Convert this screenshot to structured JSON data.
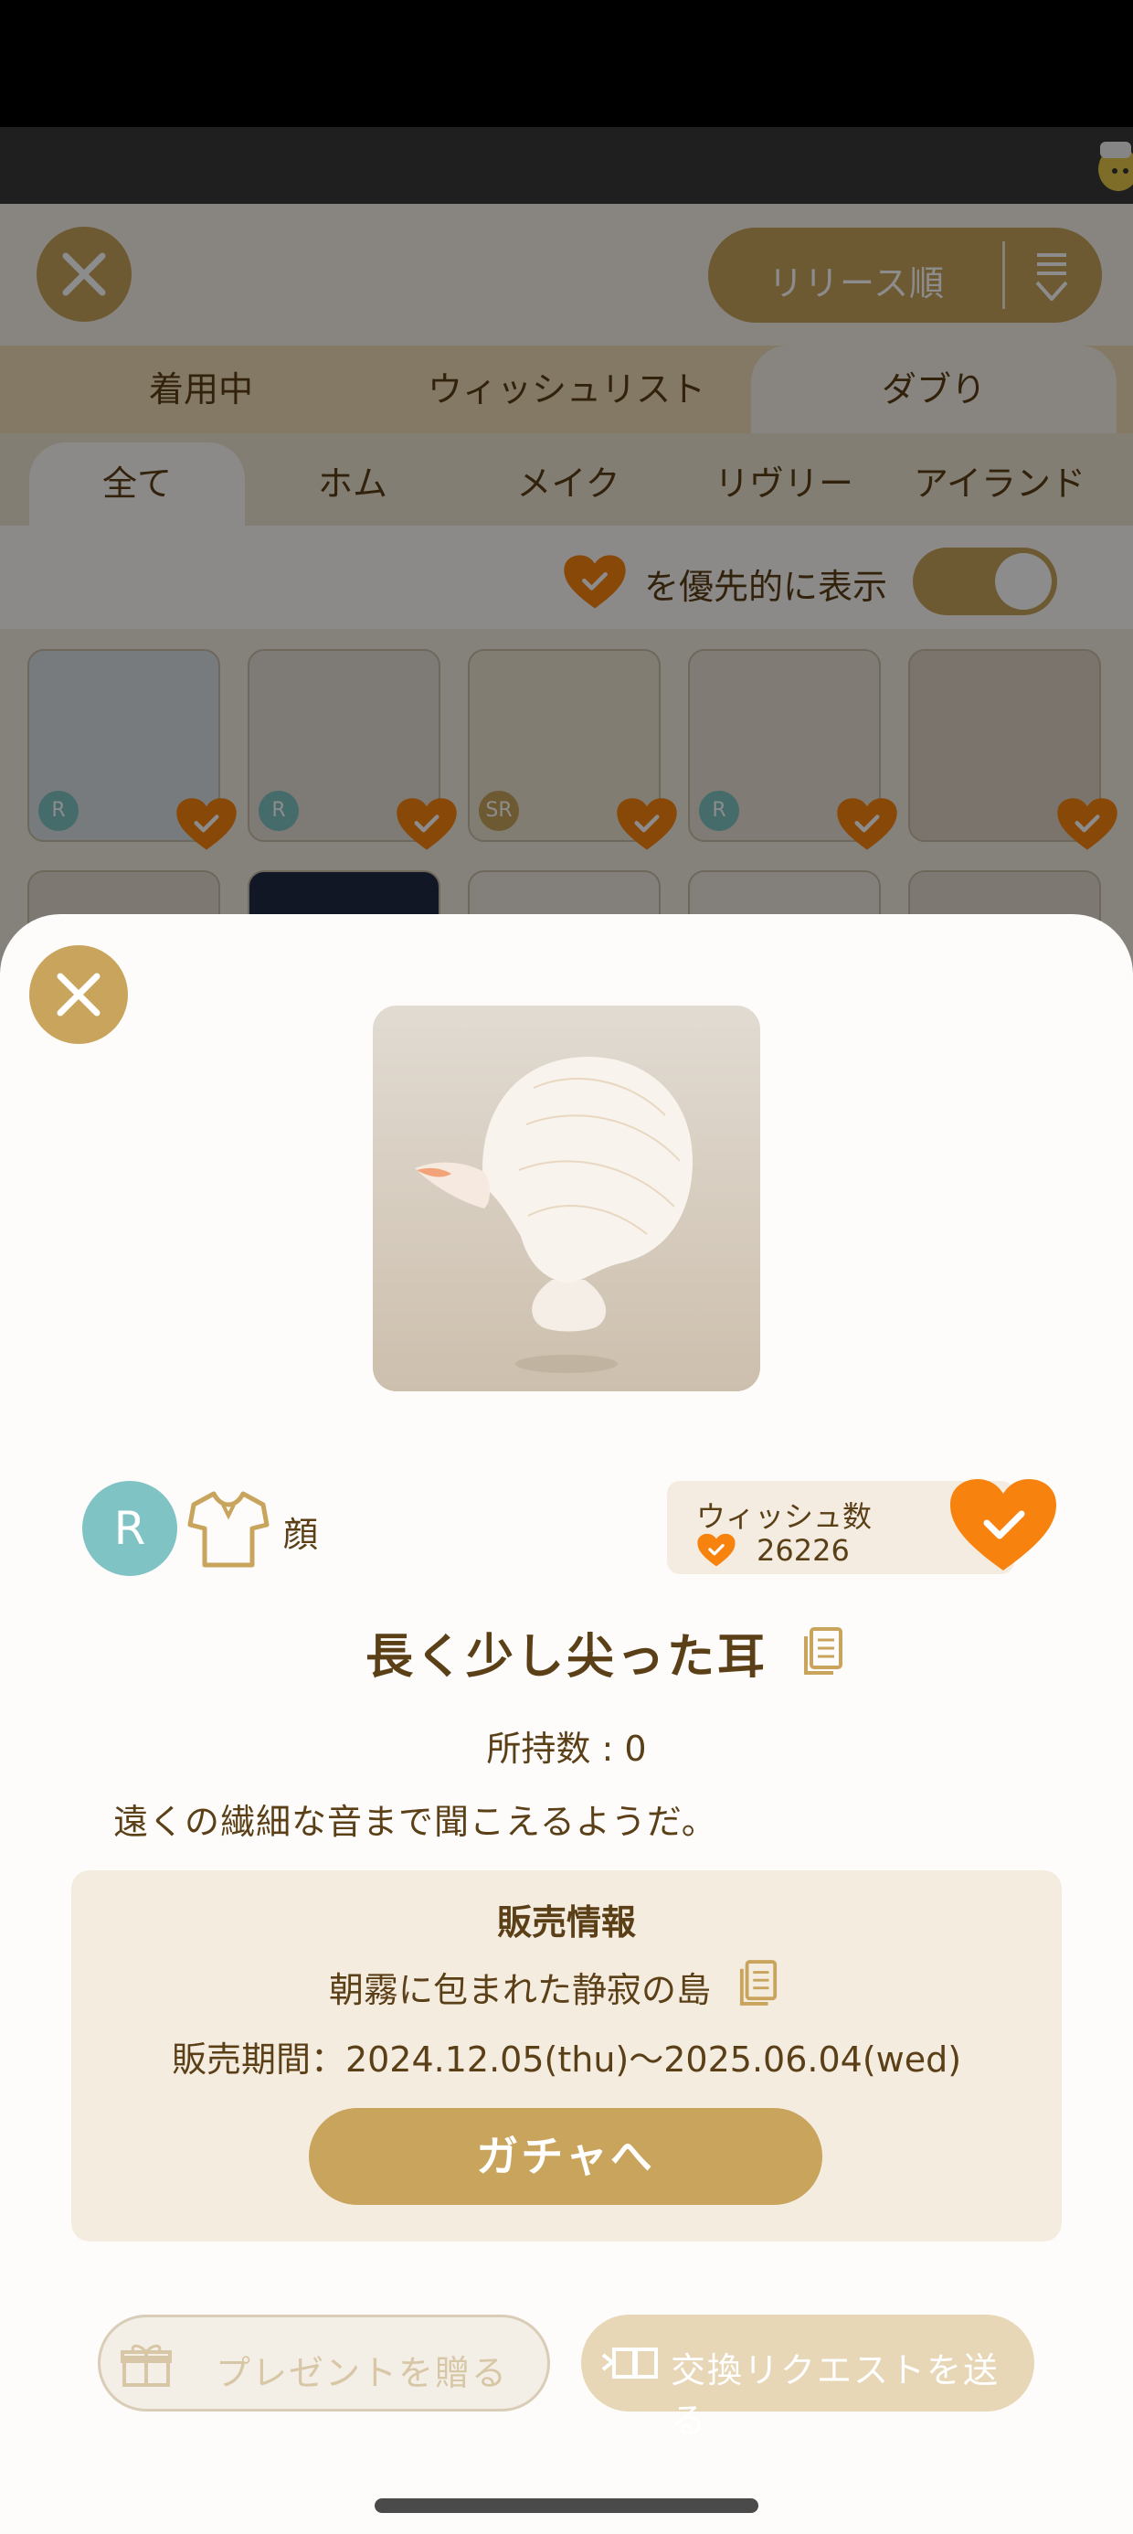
{
  "background": {
    "sort": {
      "label": "リリース順"
    },
    "tabs_primary": [
      {
        "label": "着用中"
      },
      {
        "label": "ウィッシュリスト"
      },
      {
        "label": "ダブり"
      }
    ],
    "tabs_secondary": [
      {
        "label": "全て"
      },
      {
        "label": "ホム"
      },
      {
        "label": "メイク"
      },
      {
        "label": "リヴリー"
      },
      {
        "label": "アイランド"
      }
    ],
    "priority_toggle": {
      "label": "を優先的に表示",
      "on": true
    },
    "grid_items": [
      {
        "rarity": "R"
      },
      {
        "rarity": "R"
      },
      {
        "rarity": "SR"
      },
      {
        "rarity": "R"
      },
      {
        "rarity": ""
      }
    ]
  },
  "detail": {
    "rarity": "R",
    "category": "顔",
    "wish": {
      "title": "ウィッシュ数",
      "count": "26226"
    },
    "name": "長く少し尖った耳",
    "owned": "所持数 : 0",
    "description": "遠くの繊細な音まで聞こえるようだ。",
    "sale": {
      "title": "販売情報",
      "place": "朝霧に包まれた静寂の島",
      "period": "販売期間：2024.12.05(thu)〜2025.06.04(wed)",
      "button": "ガチャへ"
    },
    "gift_button": "プレゼントを贈る",
    "trade_button": "交換リクエストを送る"
  },
  "colors": {
    "accent_gold": "#c8a45c",
    "heart_orange": "#f7830e",
    "text_brown": "#5b3f17",
    "rarity_teal": "#7fc3c4"
  },
  "icons": [
    "close-icon",
    "sort-list-icon",
    "heart-check-icon",
    "shirt-icon",
    "copy-icon",
    "gift-icon",
    "exchange-icon"
  ]
}
